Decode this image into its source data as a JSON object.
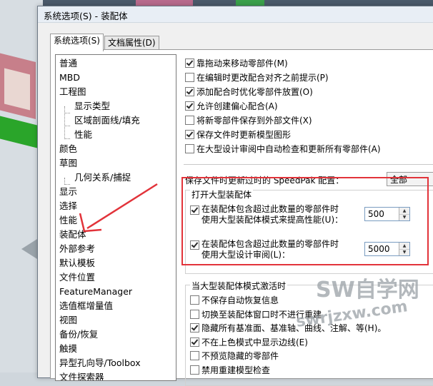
{
  "dialog": {
    "title": "系统选项(S) - 装配体",
    "tabs": [
      {
        "label": "系统选项(S)",
        "active": true
      },
      {
        "label": "文档属性(D)",
        "active": false
      }
    ]
  },
  "tree": {
    "items": [
      {
        "label": "普通",
        "level": 0
      },
      {
        "label": "MBD",
        "level": 0
      },
      {
        "label": "工程图",
        "level": 0
      },
      {
        "label": "显示类型",
        "level": 1
      },
      {
        "label": "区域剖面线/填充",
        "level": 1
      },
      {
        "label": "性能",
        "level": 1
      },
      {
        "label": "颜色",
        "level": 0
      },
      {
        "label": "草图",
        "level": 0
      },
      {
        "label": "几何关系/捕捉",
        "level": 1
      },
      {
        "label": "显示",
        "level": 0
      },
      {
        "label": "选择",
        "level": 0
      },
      {
        "label": "性能",
        "level": 0
      },
      {
        "label": "装配体",
        "level": 0,
        "selected": true
      },
      {
        "label": "外部参考",
        "level": 0
      },
      {
        "label": "默认模板",
        "level": 0
      },
      {
        "label": "文件位置",
        "level": 0
      },
      {
        "label": "FeatureManager",
        "level": 0
      },
      {
        "label": "选值框增量值",
        "level": 0
      },
      {
        "label": "视图",
        "level": 0
      },
      {
        "label": "备份/恢复",
        "level": 0
      },
      {
        "label": "触摸",
        "level": 0
      },
      {
        "label": "异型孔向导/Toolbox",
        "level": 0
      },
      {
        "label": "文件探索器",
        "level": 0
      }
    ]
  },
  "options": {
    "checkboxes": [
      {
        "label": "靠拖动来移动零部件(M)",
        "checked": true
      },
      {
        "label": "在编辑时更改配合对齐之前提示(P)",
        "checked": false
      },
      {
        "label": "添加配合时优化零部件放置(O)",
        "checked": true
      },
      {
        "label": "允许创建偏心配合(A)",
        "checked": true
      },
      {
        "label": "将新零部件保存到外部文件(X)",
        "checked": false
      },
      {
        "label": "保存文件时更新模型图形",
        "checked": true
      },
      {
        "label": "在大型设计审阅中自动检查和更新所有零部件(A)",
        "checked": false
      }
    ],
    "speedpak": {
      "label": "保存文件时更新过时的 SpeedPak 配置：",
      "value": "全部"
    },
    "large_assembly": {
      "title": "打开大型装配体",
      "lightweight": {
        "line1": "在装配体包含超过此数量的零部件时",
        "line2": "使用大型装配体模式来提高性能(U)：",
        "checked": true,
        "value": "500"
      },
      "review": {
        "line1": "在装配体包含超过此数量的零部件时",
        "line2": "使用大型设计审阅(L)：",
        "checked": true,
        "value": "5000"
      }
    },
    "mode_group": {
      "title": "当大型装配体模式激活时",
      "checkboxes": [
        {
          "label": "不保存自动恢复信息",
          "checked": false
        },
        {
          "label": "切换至装配体窗口时不进行重建",
          "checked": false
        },
        {
          "label": "隐藏所有基准面、基准轴、曲线、注解、等(H)。",
          "checked": true
        },
        {
          "label": "不在上色模式中显示边线(E)",
          "checked": true
        },
        {
          "label": "不预览隐藏的零部件",
          "checked": false
        },
        {
          "label": "禁用重建模型检查",
          "checked": false
        }
      ]
    }
  },
  "watermark": {
    "line1": "SW自学网",
    "line2": "swrjzxw.com"
  },
  "colors": {
    "annotation_red": "#e2333a",
    "watermark": "#9aa0a6"
  }
}
